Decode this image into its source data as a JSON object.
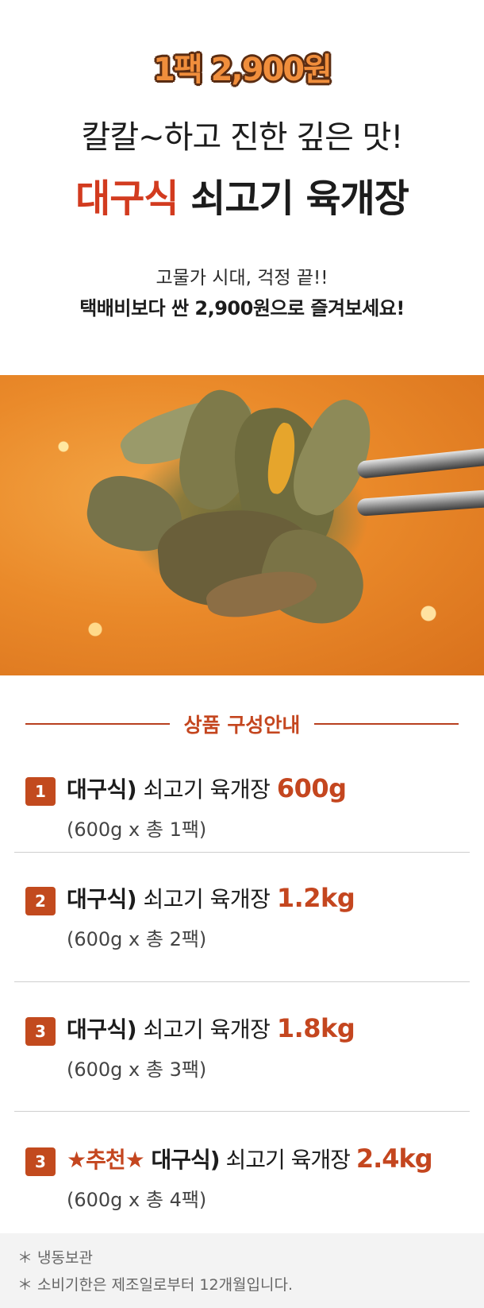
{
  "hero": {
    "price_badge": "1팩 2,900원",
    "headline_line1": "칼칼~하고 진한 깊은 맛!",
    "headline_accent": "대구식",
    "headline_rest": " 쇠고기 육개장",
    "sub_line1": "고물가 시대, 걱정 끝!!",
    "sub_line2": "택배비보다 싼 2,900원으로 즐겨보세요!"
  },
  "section": {
    "title": "상품 구성안내"
  },
  "items": [
    {
      "num": "1",
      "star": "",
      "brand": "대구식)",
      "product": " 쇠고기 육개장 ",
      "size": "600g",
      "detail": "(600g x 총 1팩)"
    },
    {
      "num": "2",
      "star": "",
      "brand": "대구식)",
      "product": " 쇠고기 육개장 ",
      "size": "1.2kg",
      "detail": "(600g x 총 2팩)"
    },
    {
      "num": "3",
      "star": "",
      "brand": "대구식)",
      "product": " 쇠고기 육개장 ",
      "size": "1.8kg",
      "detail": "(600g x 총 3팩)"
    },
    {
      "num": "3",
      "star": "★추천★ ",
      "brand": "대구식)",
      "product": " 쇠고기 육개장 ",
      "size": "2.4kg",
      "detail": "(600g x 총 4팩)"
    }
  ],
  "footer": {
    "note1": "＊ 냉동보관",
    "note2": "＊ 소비기한은 제조일로부터 12개월입니다."
  },
  "colors": {
    "accent": "#c4461f",
    "badge": "#c24a1e",
    "price_fill": "#f08e3c"
  }
}
